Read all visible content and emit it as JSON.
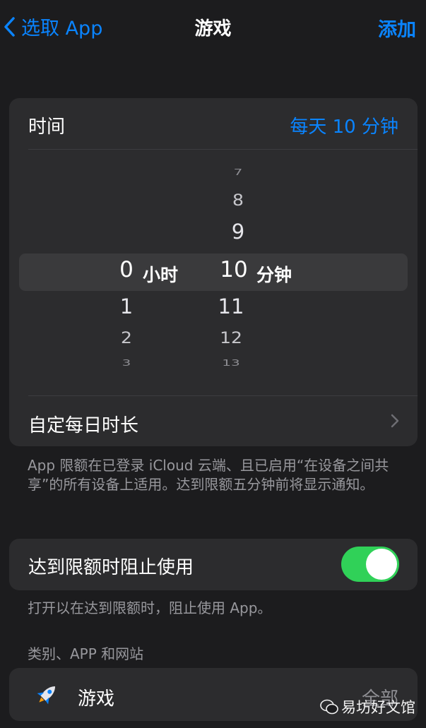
{
  "nav": {
    "back_label": "选取 App",
    "title": "游戏",
    "action_label": "添加"
  },
  "time_row": {
    "label": "时间",
    "value": "每天 10 分钟"
  },
  "picker": {
    "hours": {
      "above": [],
      "selected": "0",
      "below": [
        "1",
        "2",
        "3"
      ],
      "unit": "小时"
    },
    "minutes": {
      "above": [
        "7",
        "8",
        "9"
      ],
      "selected": "10",
      "below": [
        "11",
        "12",
        "13"
      ],
      "unit": "分钟"
    }
  },
  "custom_row": {
    "label": "自定每日时长"
  },
  "footer1": "App 限额在已登录 iCloud 云端、且已启用“在设备之间共享”的所有设备上适用。达到限额五分钟前将显示通知。",
  "block_row": {
    "label": "达到限额时阻止使用",
    "toggle_on": true
  },
  "footer2": "打开以在达到限额时，阻止使用 App。",
  "section_header": "类别、APP 和网站",
  "category_row": {
    "icon": "rocket-icon",
    "label": "游戏",
    "value": "全部"
  },
  "watermark": "易坊好文馆",
  "colors": {
    "accent": "#0a84ff",
    "toggle_on": "#30d158",
    "background": "#1c1c1e",
    "card": "#2c2c2e"
  }
}
